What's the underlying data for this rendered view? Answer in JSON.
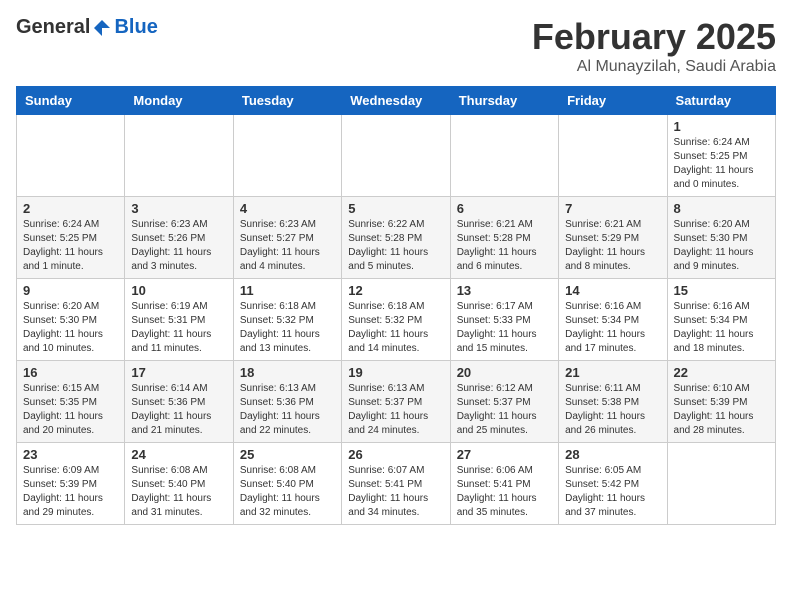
{
  "logo": {
    "general": "General",
    "blue": "Blue"
  },
  "title": "February 2025",
  "subtitle": "Al Munayzilah, Saudi Arabia",
  "headers": [
    "Sunday",
    "Monday",
    "Tuesday",
    "Wednesday",
    "Thursday",
    "Friday",
    "Saturday"
  ],
  "weeks": [
    [
      {
        "day": "",
        "info": ""
      },
      {
        "day": "",
        "info": ""
      },
      {
        "day": "",
        "info": ""
      },
      {
        "day": "",
        "info": ""
      },
      {
        "day": "",
        "info": ""
      },
      {
        "day": "",
        "info": ""
      },
      {
        "day": "1",
        "info": "Sunrise: 6:24 AM\nSunset: 5:25 PM\nDaylight: 11 hours\nand 0 minutes."
      }
    ],
    [
      {
        "day": "2",
        "info": "Sunrise: 6:24 AM\nSunset: 5:25 PM\nDaylight: 11 hours\nand 1 minute."
      },
      {
        "day": "3",
        "info": "Sunrise: 6:23 AM\nSunset: 5:26 PM\nDaylight: 11 hours\nand 3 minutes."
      },
      {
        "day": "4",
        "info": "Sunrise: 6:23 AM\nSunset: 5:27 PM\nDaylight: 11 hours\nand 4 minutes."
      },
      {
        "day": "5",
        "info": "Sunrise: 6:22 AM\nSunset: 5:28 PM\nDaylight: 11 hours\nand 5 minutes."
      },
      {
        "day": "6",
        "info": "Sunrise: 6:21 AM\nSunset: 5:28 PM\nDaylight: 11 hours\nand 6 minutes."
      },
      {
        "day": "7",
        "info": "Sunrise: 6:21 AM\nSunset: 5:29 PM\nDaylight: 11 hours\nand 8 minutes."
      },
      {
        "day": "8",
        "info": "Sunrise: 6:20 AM\nSunset: 5:30 PM\nDaylight: 11 hours\nand 9 minutes."
      }
    ],
    [
      {
        "day": "9",
        "info": "Sunrise: 6:20 AM\nSunset: 5:30 PM\nDaylight: 11 hours\nand 10 minutes."
      },
      {
        "day": "10",
        "info": "Sunrise: 6:19 AM\nSunset: 5:31 PM\nDaylight: 11 hours\nand 11 minutes."
      },
      {
        "day": "11",
        "info": "Sunrise: 6:18 AM\nSunset: 5:32 PM\nDaylight: 11 hours\nand 13 minutes."
      },
      {
        "day": "12",
        "info": "Sunrise: 6:18 AM\nSunset: 5:32 PM\nDaylight: 11 hours\nand 14 minutes."
      },
      {
        "day": "13",
        "info": "Sunrise: 6:17 AM\nSunset: 5:33 PM\nDaylight: 11 hours\nand 15 minutes."
      },
      {
        "day": "14",
        "info": "Sunrise: 6:16 AM\nSunset: 5:34 PM\nDaylight: 11 hours\nand 17 minutes."
      },
      {
        "day": "15",
        "info": "Sunrise: 6:16 AM\nSunset: 5:34 PM\nDaylight: 11 hours\nand 18 minutes."
      }
    ],
    [
      {
        "day": "16",
        "info": "Sunrise: 6:15 AM\nSunset: 5:35 PM\nDaylight: 11 hours\nand 20 minutes."
      },
      {
        "day": "17",
        "info": "Sunrise: 6:14 AM\nSunset: 5:36 PM\nDaylight: 11 hours\nand 21 minutes."
      },
      {
        "day": "18",
        "info": "Sunrise: 6:13 AM\nSunset: 5:36 PM\nDaylight: 11 hours\nand 22 minutes."
      },
      {
        "day": "19",
        "info": "Sunrise: 6:13 AM\nSunset: 5:37 PM\nDaylight: 11 hours\nand 24 minutes."
      },
      {
        "day": "20",
        "info": "Sunrise: 6:12 AM\nSunset: 5:37 PM\nDaylight: 11 hours\nand 25 minutes."
      },
      {
        "day": "21",
        "info": "Sunrise: 6:11 AM\nSunset: 5:38 PM\nDaylight: 11 hours\nand 26 minutes."
      },
      {
        "day": "22",
        "info": "Sunrise: 6:10 AM\nSunset: 5:39 PM\nDaylight: 11 hours\nand 28 minutes."
      }
    ],
    [
      {
        "day": "23",
        "info": "Sunrise: 6:09 AM\nSunset: 5:39 PM\nDaylight: 11 hours\nand 29 minutes."
      },
      {
        "day": "24",
        "info": "Sunrise: 6:08 AM\nSunset: 5:40 PM\nDaylight: 11 hours\nand 31 minutes."
      },
      {
        "day": "25",
        "info": "Sunrise: 6:08 AM\nSunset: 5:40 PM\nDaylight: 11 hours\nand 32 minutes."
      },
      {
        "day": "26",
        "info": "Sunrise: 6:07 AM\nSunset: 5:41 PM\nDaylight: 11 hours\nand 34 minutes."
      },
      {
        "day": "27",
        "info": "Sunrise: 6:06 AM\nSunset: 5:41 PM\nDaylight: 11 hours\nand 35 minutes."
      },
      {
        "day": "28",
        "info": "Sunrise: 6:05 AM\nSunset: 5:42 PM\nDaylight: 11 hours\nand 37 minutes."
      },
      {
        "day": "",
        "info": ""
      }
    ]
  ]
}
